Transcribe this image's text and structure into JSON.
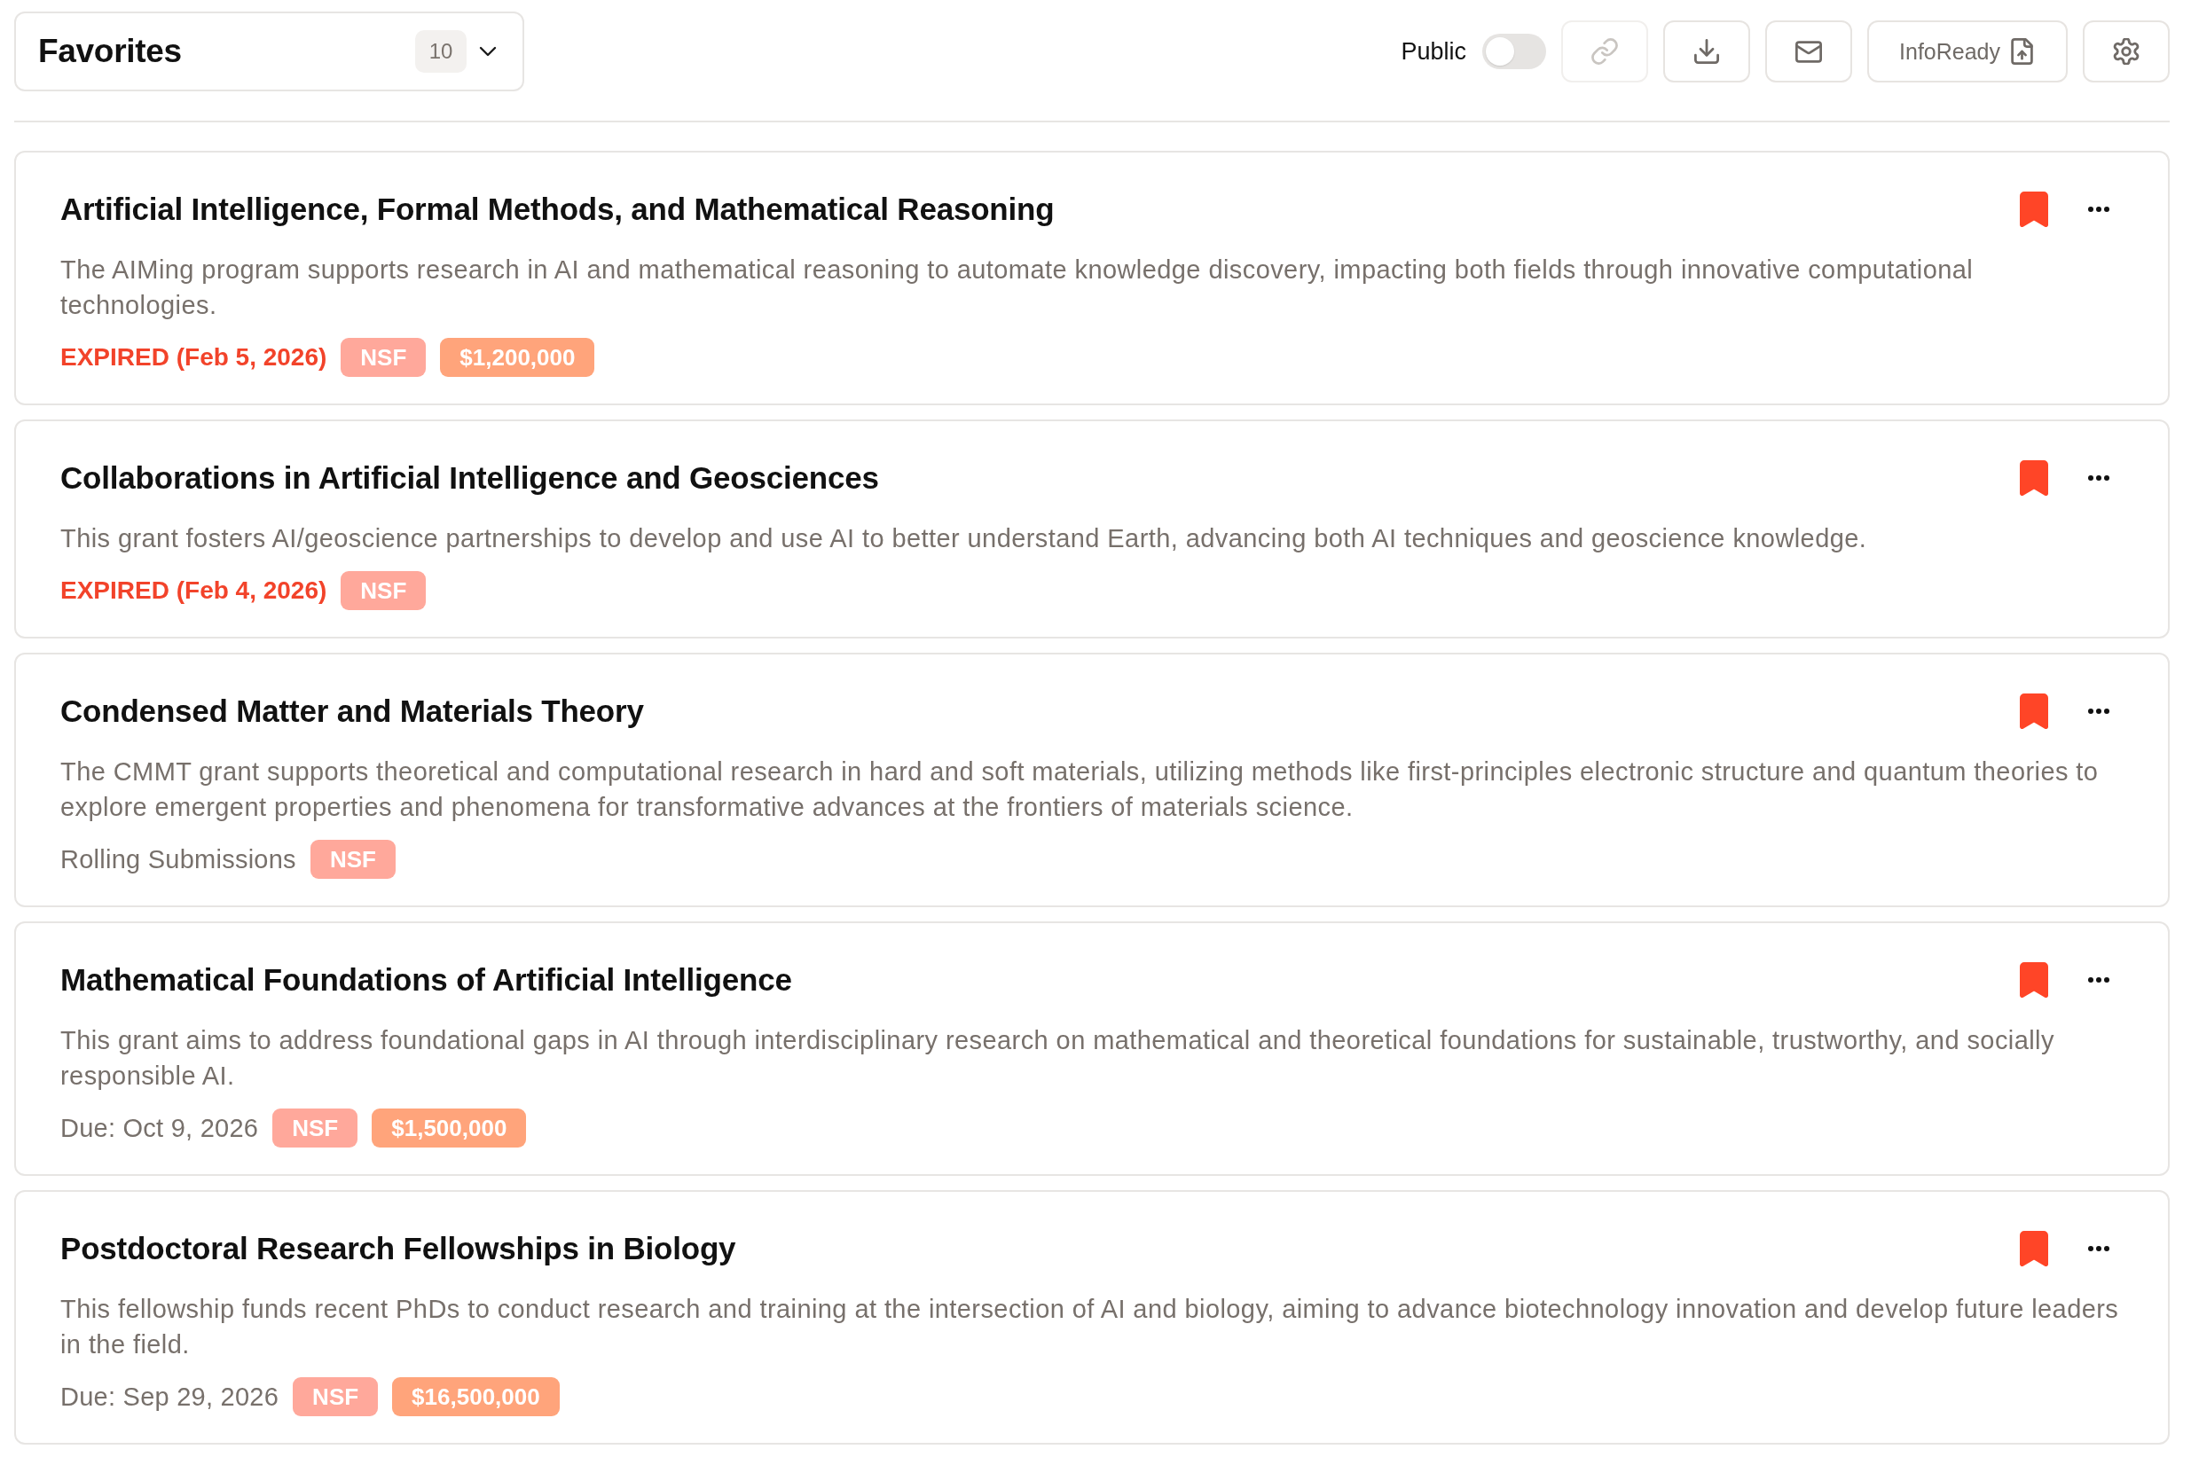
{
  "header": {
    "list": {
      "title": "Favorites",
      "count": "10"
    },
    "public_toggle": {
      "label": "Public",
      "on": false
    },
    "toolbar": [
      {
        "kind": "link",
        "disabled": true
      },
      {
        "kind": "download",
        "disabled": false
      },
      {
        "kind": "mail",
        "disabled": false
      },
      {
        "kind": "export",
        "label": "InfoReady",
        "disabled": false
      },
      {
        "kind": "settings",
        "disabled": false
      }
    ]
  },
  "grants": [
    {
      "title": "Artificial Intelligence, Formal Methods, and Mathematical Reasoning",
      "description": "The AIMing program supports research in AI and mathematical reasoning to automate knowledge discovery, impacting both fields through innovative computational technologies.",
      "bookmarked": true,
      "deadline": {
        "kind": "expired",
        "text": "EXPIRED (Feb 5, 2026)"
      },
      "tags": [
        {
          "kind": "agency",
          "text": "NSF"
        },
        {
          "kind": "amount",
          "text": "$1,200,000"
        }
      ]
    },
    {
      "title": "Collaborations in Artificial Intelligence and Geosciences",
      "description": "This grant fosters AI/geoscience partnerships to develop and use AI to better understand Earth, advancing both AI techniques and geoscience knowledge.",
      "bookmarked": true,
      "deadline": {
        "kind": "expired",
        "text": "EXPIRED (Feb 4, 2026)"
      },
      "tags": [
        {
          "kind": "agency",
          "text": "NSF"
        }
      ]
    },
    {
      "title": "Condensed Matter and Materials Theory",
      "description": "The CMMT grant supports theoretical and computational research in hard and soft materials, utilizing methods like first-principles electronic structure and quantum theories to explore emergent properties and phenomena for transformative advances at the frontiers of materials science.",
      "bookmarked": true,
      "deadline": {
        "kind": "rolling",
        "text": "Rolling Submissions"
      },
      "tags": [
        {
          "kind": "agency",
          "text": "NSF"
        }
      ]
    },
    {
      "title": "Mathematical Foundations of Artificial Intelligence",
      "description": "This grant aims to address foundational gaps in AI through interdisciplinary research on mathematical and theoretical foundations for sustainable, trustworthy, and socially responsible AI.",
      "bookmarked": true,
      "deadline": {
        "kind": "due",
        "text": "Due: Oct 9, 2026"
      },
      "tags": [
        {
          "kind": "agency",
          "text": "NSF"
        },
        {
          "kind": "amount",
          "text": "$1,500,000"
        }
      ]
    },
    {
      "title": "Postdoctoral Research Fellowships in Biology",
      "description": "This fellowship funds recent PhDs to conduct research and training at the intersection of AI and biology, aiming to advance biotechnology innovation and develop future leaders in the field.",
      "bookmarked": true,
      "deadline": {
        "kind": "due",
        "text": "Due: Sep 29, 2026"
      },
      "tags": [
        {
          "kind": "agency",
          "text": "NSF"
        },
        {
          "kind": "amount",
          "text": "$16,500,000"
        }
      ]
    }
  ]
}
